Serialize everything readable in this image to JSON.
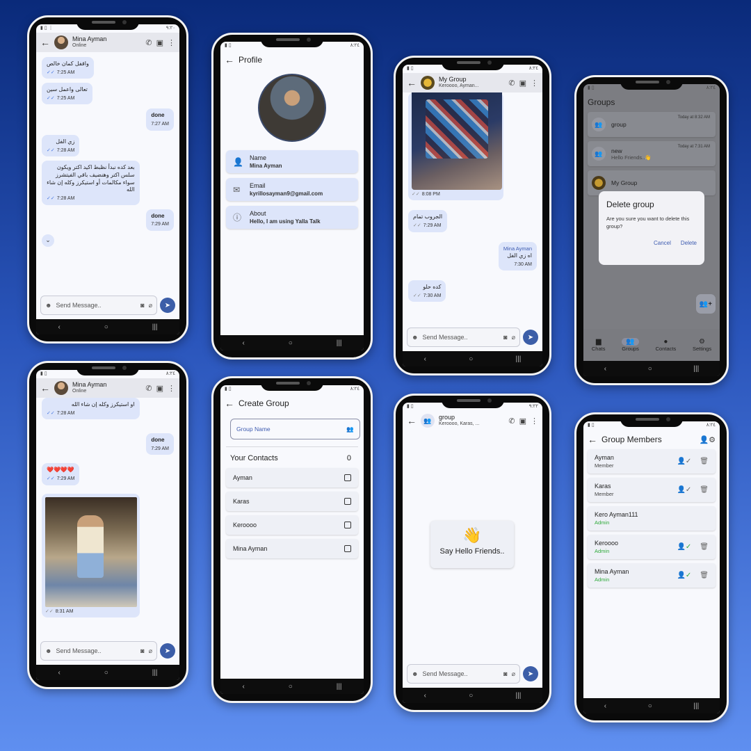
{
  "status": {
    "time1": "٩:٢٠",
    "time2": "٨:٢٤",
    "time3": "٨:٢٤",
    "time4": "٨:٢٤",
    "time5": "٨:٢٤",
    "time6": "٨:٢٤",
    "time7": "٩:٢٢",
    "time8": "٨:٢٤"
  },
  "chat1": {
    "name": "Mina Ayman",
    "sub": "Online",
    "messages": [
      {
        "text": "واقفل كمان خالص",
        "time": "7:25 AM",
        "side": "left"
      },
      {
        "text": "تعالى واعمل سين",
        "time": "7:25 AM",
        "side": "left"
      },
      {
        "text": "done",
        "time": "7:27 AM",
        "side": "right"
      },
      {
        "text": "زي الفل",
        "time": "7:28 AM",
        "side": "left"
      },
      {
        "text": "بعد كده نبدأ نظبط اكيد اكتر ويكون سلس اكتر وهنضيف باقي الفيتشرز سواء مكالمات أو استيكرز وكله إن شاء الله",
        "time": "7:28 AM",
        "side": "left"
      },
      {
        "text": "done",
        "time": "7:29 AM",
        "side": "right"
      }
    ],
    "scroll_icon": "double-chevron-down-icon",
    "placeholder": "Send Message.."
  },
  "profile": {
    "title": "Profile",
    "fields": [
      {
        "label": "Name",
        "value": "Mina Ayman"
      },
      {
        "label": "Email",
        "value": "kyrillosayman9@gmail.com"
      },
      {
        "label": "About",
        "value": "Hello, I am using Yalla Talk"
      }
    ]
  },
  "groupchat": {
    "name": "My Group",
    "sub": "Keroooo, Ayman...",
    "messages": [
      {
        "text": "",
        "time": "8:08 PM",
        "side": "left",
        "image": true
      },
      {
        "text": "الجروب تمام",
        "time": "7:29 AM",
        "side": "left"
      },
      {
        "who": "Mina Ayman",
        "text": "اه زي الفل",
        "time": "7:30 AM",
        "side": "right"
      },
      {
        "text": "كده حلو",
        "time": "7:30 AM",
        "side": "left"
      }
    ],
    "placeholder": "Send Message.."
  },
  "groups": {
    "title": "Groups",
    "items": [
      {
        "name": "group",
        "sub": "",
        "time": "Today at 8:32 AM"
      },
      {
        "name": "new",
        "sub": "Hello Friends..👋",
        "time": "Today at 7:31 AM"
      },
      {
        "name": "My Group",
        "sub": "",
        "time": ""
      }
    ],
    "dialog": {
      "title": "Delete group",
      "body": "Are you sure you want to delete this group?",
      "cancel": "Cancel",
      "confirm": "Delete"
    },
    "tabs": [
      "Chats",
      "Groups",
      "Contacts",
      "Settings"
    ]
  },
  "chat2": {
    "name": "Mina Ayman",
    "sub": "Online",
    "messages": [
      {
        "text": "او استيكرز وكله إن شاء الله",
        "time": "7:28 AM",
        "side": "left"
      },
      {
        "text": "done",
        "time": "7:29 AM",
        "side": "right"
      },
      {
        "text": "❤️❤️❤️❤️",
        "time": "7:29 AM",
        "side": "left"
      },
      {
        "text": "",
        "time": "8:31 AM",
        "side": "left",
        "image": true
      }
    ],
    "placeholder": "Send Message.."
  },
  "creategroup": {
    "title": "Create Group",
    "placeholder": "Group Name",
    "contacts_label": "Your Contacts",
    "count": "0",
    "contacts": [
      "Ayman",
      "Karas",
      "Keroooo",
      "Mina Ayman"
    ]
  },
  "emptygroup": {
    "name": "group",
    "sub": "Keroooo, Karas, ...",
    "hello": "Say Hello Friends..",
    "wave": "👋",
    "placeholder": "Send Message.."
  },
  "members": {
    "title": "Group Members",
    "items": [
      {
        "name": "Ayman",
        "role": "Member",
        "admin": false,
        "actions": true
      },
      {
        "name": "Karas",
        "role": "Member",
        "admin": false,
        "actions": true
      },
      {
        "name": "Kero Ayman111",
        "role": "Admin",
        "admin": true,
        "actions": false
      },
      {
        "name": "Keroooo",
        "role": "Admin",
        "admin": true,
        "actions": true
      },
      {
        "name": "Mina Ayman",
        "role": "Admin",
        "admin": true,
        "actions": true
      }
    ]
  }
}
